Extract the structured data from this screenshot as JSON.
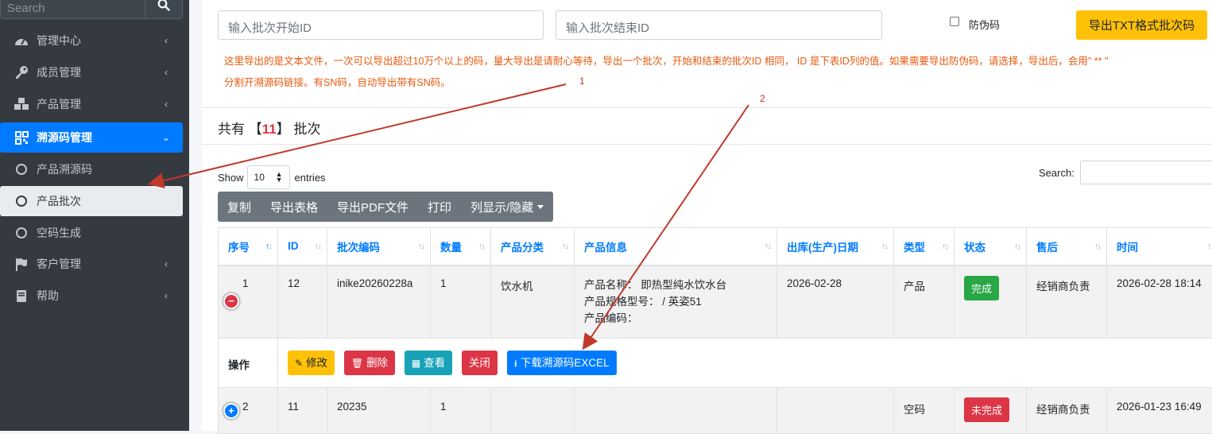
{
  "sidebar": {
    "search_placeholder": "Search",
    "items": [
      {
        "label": "管理中心",
        "icon": "dashboard-icon",
        "chevron": "‹"
      },
      {
        "label": "成员管理",
        "icon": "key-icon",
        "chevron": "‹"
      },
      {
        "label": "产品管理",
        "icon": "cubes-icon",
        "chevron": "‹"
      },
      {
        "label": "溯源码管理",
        "icon": "qrcode-icon",
        "chevron": "⌄"
      },
      {
        "label": "产品溯源码",
        "icon": "circle-icon"
      },
      {
        "label": "产品批次",
        "icon": "circle-icon"
      },
      {
        "label": "空码生成",
        "icon": "circle-icon"
      },
      {
        "label": "客户管理",
        "icon": "flag-icon",
        "chevron": "‹"
      },
      {
        "label": "帮助",
        "icon": "book-icon",
        "chevron": "‹"
      }
    ]
  },
  "filters": {
    "start_placeholder": "输入批次开始ID",
    "end_placeholder": "输入批次结束ID",
    "anti_fake_label": "防伪码",
    "export_txt": "导出TXT格式批次码"
  },
  "notes": {
    "line1": "这里导出的是文本文件，一次可以导出超过10万个以上的码，量大导出是请耐心等待，导出一个批次，开始和结束的批次ID 相同， ID 是下表ID列的值。如果需要导出防伪码，请选择，导出后，会用\" ** \"",
    "line2": "分割开溯源码链接。有SN码，自动导出带有SN码。"
  },
  "summary": {
    "prefix": "共有 【",
    "count": "11",
    "suffix": "】 批次"
  },
  "datatable": {
    "show_label": "Show",
    "length": "10",
    "entries_label": "entries",
    "search_label": "Search:",
    "buttons": [
      "复制",
      "导出表格",
      "导出PDF文件",
      "打印",
      "列显示/隐藏"
    ]
  },
  "table": {
    "headers": [
      "序号",
      "ID",
      "批次编码",
      "数量",
      "产品分类",
      "产品信息",
      "出库(生产)日期",
      "类型",
      "状态",
      "售后",
      "时间"
    ],
    "rows": [
      {
        "index": "1",
        "id": "12",
        "code": "inike20260228a",
        "qty": "1",
        "category": "饮水机",
        "info": [
          "产品名称： 即热型纯水饮水台",
          "产品规格型号： / 英姿51",
          "产品编码："
        ],
        "date": "2026-02-28",
        "type": "产品",
        "status": "完成",
        "after_sale": "经销商负责",
        "time": "2026-02-28 18:14"
      },
      {
        "index": "2",
        "id": "11",
        "code": "20235",
        "qty": "1",
        "category": "",
        "info": [],
        "date": "",
        "type": "空码",
        "status": "未完成",
        "after_sale": "经销商负责",
        "time": "2026-01-23 16:49"
      }
    ],
    "actions_label": "操作",
    "actions": [
      "修改",
      "删除",
      "查看",
      "关闭",
      "下载溯源码EXCEL"
    ]
  },
  "annotations": {
    "one": "1",
    "two": "2"
  },
  "colors": {
    "primary": "#007bff",
    "success": "#28a745",
    "danger": "#dc3545",
    "warning": "#ffc107",
    "info": "#17a2b8",
    "arrow": "#c0392b"
  }
}
